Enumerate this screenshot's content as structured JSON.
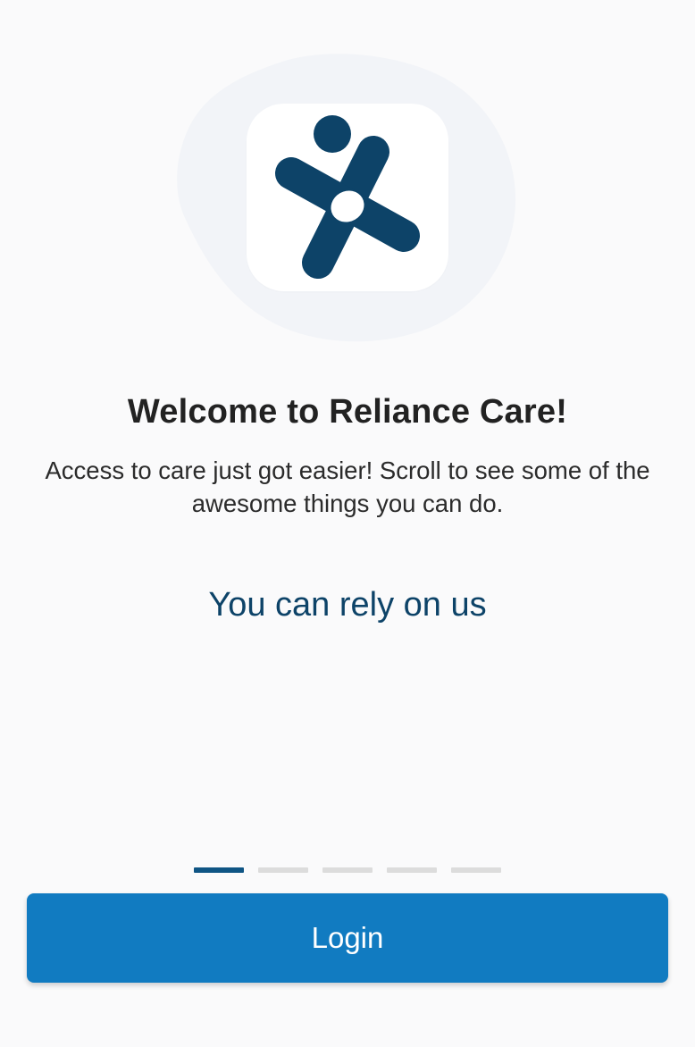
{
  "onboarding": {
    "title": "Welcome to Reliance Care!",
    "subtitle": "Access to care just got easier! Scroll to see some of the awesome things you can do.",
    "slide_heading": "You can rely on us",
    "pager": {
      "total": 5,
      "active_index": 0
    },
    "login_label": "Login"
  },
  "colors": {
    "brand_dark": "#0d4368",
    "brand_blue": "#117bc1",
    "pager_active": "#0f5584",
    "pager_inactive": "#dcdcdc"
  },
  "icons": {
    "logo": "reliance-care-logo-icon"
  }
}
